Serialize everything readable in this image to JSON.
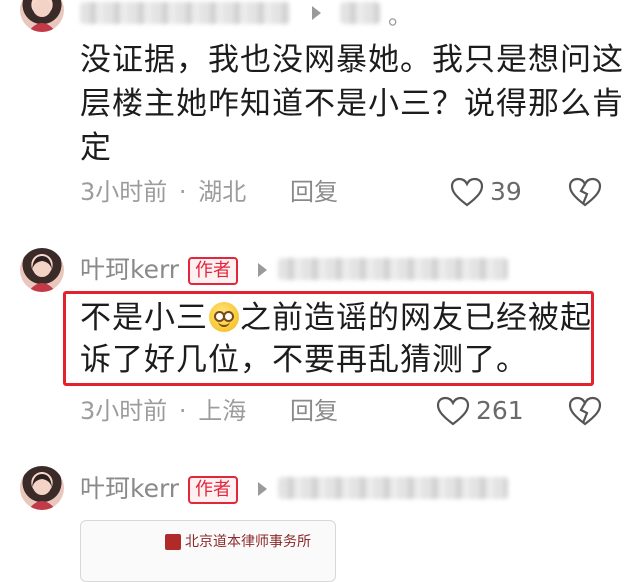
{
  "comment1": {
    "username_blurred": true,
    "text_line1": "没证据，我也没网暴她。我只是想问这",
    "text_line2": "层楼主她咋知道不是小三？说得那么肯",
    "text_line3": "定",
    "time": "3小时前",
    "dot": "·",
    "location": "湖北",
    "reply_label": "回复",
    "likes": "39",
    "partial_char": "。"
  },
  "comment2": {
    "username": "叶珂kerr",
    "badge": "作者",
    "text_line1_a": "不是小三",
    "text_line1_b": "之前造谣的网友已经被起",
    "text_line2": "诉了好几位，不要再乱猜测了。",
    "time": "3小时前",
    "dot": "·",
    "location": "上海",
    "reply_label": "回复",
    "likes": "261"
  },
  "comment3": {
    "username": "叶珂kerr",
    "badge": "作者",
    "card_text": "北京道本律师事务所"
  },
  "colors": {
    "accent_red": "#e2273d",
    "highlight_border": "#e2232f",
    "meta_gray": "#9c9c9c"
  },
  "icons": {
    "like": "heart-outline-icon",
    "dislike": "broken-heart-icon",
    "arrow": "play-triangle-icon",
    "emoji": "smiling-emoji-icon"
  }
}
